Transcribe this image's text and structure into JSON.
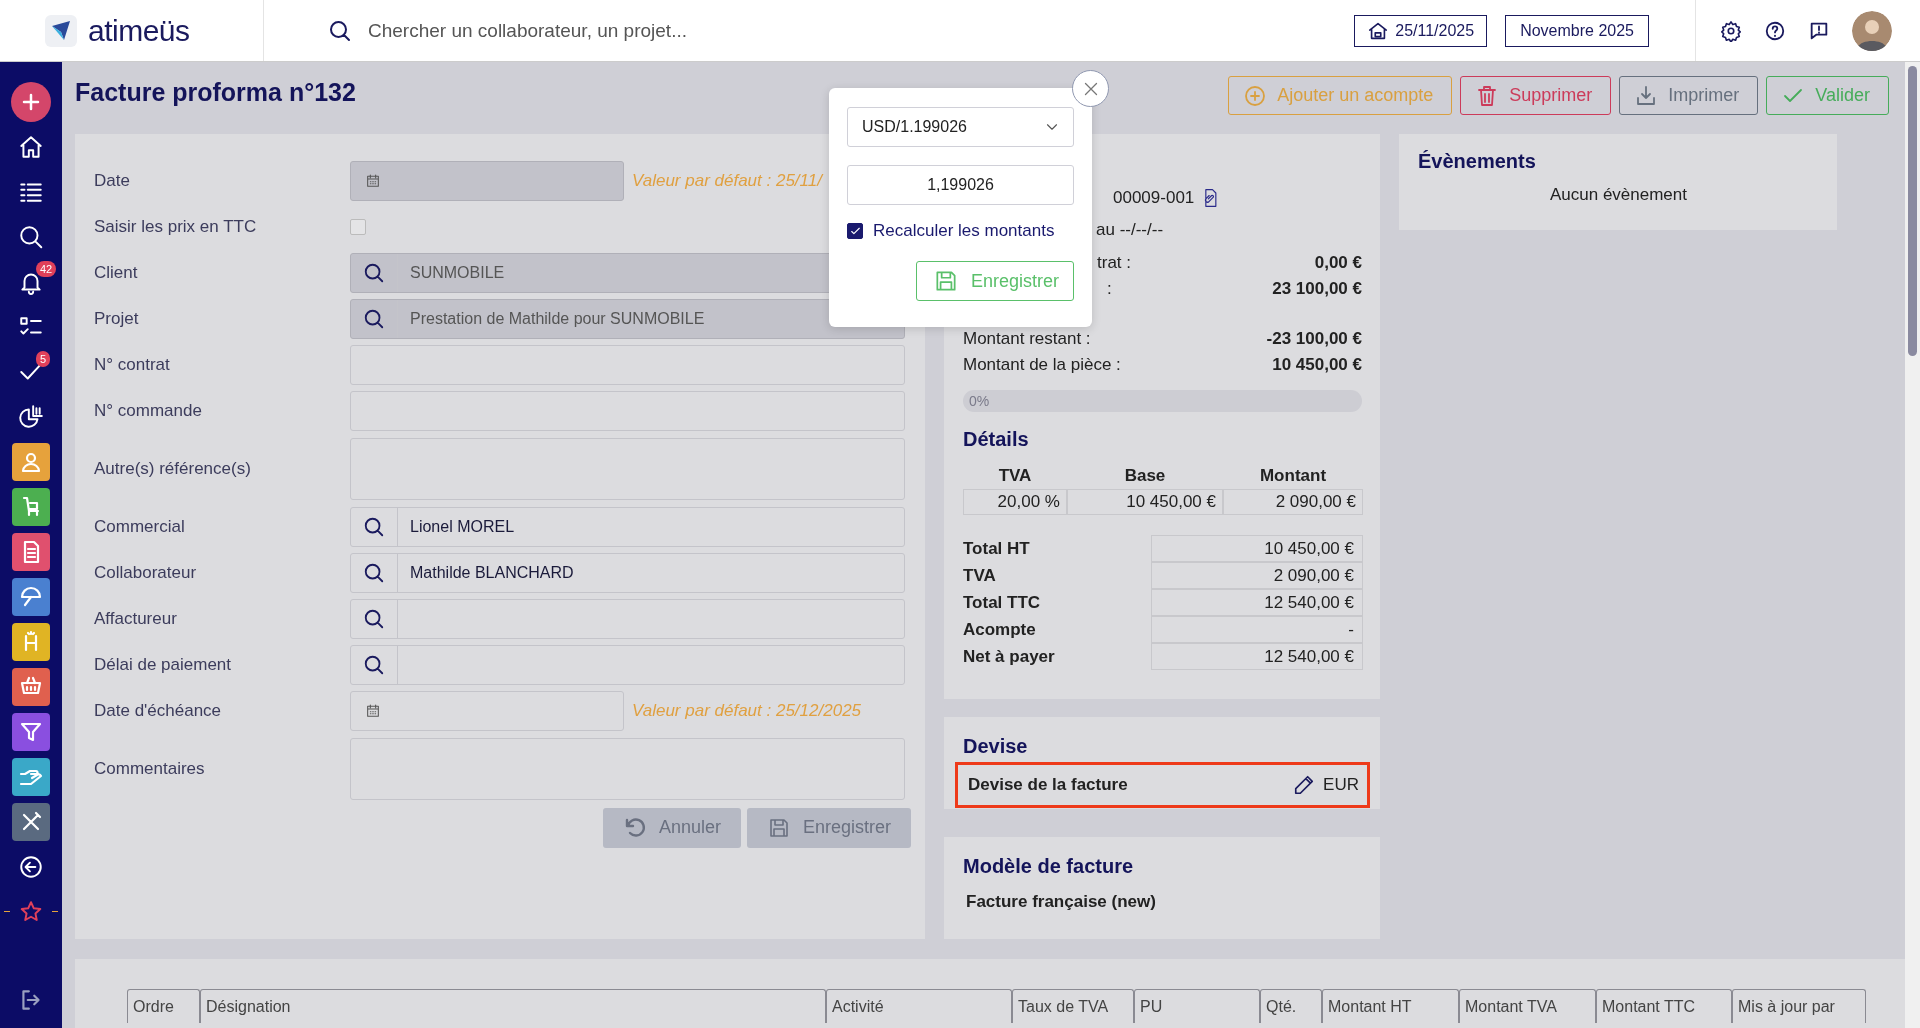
{
  "topbar": {
    "logo": "atimeüs",
    "search": {
      "placeholder": "Chercher un collaborateur, un projet..."
    },
    "date": "25/11/2025",
    "period": "Novembre 2025"
  },
  "sidebar": {
    "items": [
      {
        "kind": "round"
      },
      {
        "kind": "icon"
      },
      {
        "kind": "icon"
      },
      {
        "kind": "icon"
      },
      {
        "kind": "icon",
        "badge": "42"
      },
      {
        "kind": "icon"
      },
      {
        "kind": "icon",
        "badge": "5"
      },
      {
        "kind": "icon"
      },
      {
        "kind": "tile",
        "color": "#e6a23c"
      },
      {
        "kind": "tile",
        "color": "#4caf50"
      },
      {
        "kind": "tile",
        "color": "#e0506e"
      },
      {
        "kind": "tile",
        "color": "#4a80d0"
      },
      {
        "kind": "tile",
        "color": "#e0b424"
      },
      {
        "kind": "tile",
        "color": "#e0604e"
      },
      {
        "kind": "tile",
        "color": "#8a4fe0"
      },
      {
        "kind": "tile",
        "color": "#3aa8c8"
      },
      {
        "kind": "tile",
        "color": "#5a6a80"
      },
      {
        "kind": "icon"
      },
      {
        "kind": "favorite"
      },
      {
        "kind": "bottom"
      }
    ]
  },
  "page": {
    "title": "Facture proforma n°132",
    "actions": [
      {
        "label": "Ajouter un acompte",
        "kind": "add"
      },
      {
        "label": "Supprimer",
        "kind": "delete"
      },
      {
        "label": "Imprimer",
        "kind": "print"
      },
      {
        "label": "Valider",
        "kind": "validate"
      }
    ]
  },
  "form": {
    "fields": [
      {
        "label": "Date",
        "kind": "date",
        "disabled": true,
        "hint": "Valeur par défaut : 25/11/"
      },
      {
        "label": "Saisir les prix en TTC",
        "kind": "checkbox",
        "checked": false
      },
      {
        "label": "Client",
        "kind": "lookup",
        "value": "SUNMOBILE",
        "disabled": true
      },
      {
        "label": "Projet",
        "kind": "lookup",
        "value": "Prestation de Mathilde pour SUNMOBILE",
        "disabled": true
      },
      {
        "label": "N° contrat",
        "kind": "text"
      },
      {
        "label": "N° commande",
        "kind": "text"
      },
      {
        "label": "Autre(s) référence(s)",
        "kind": "textarea"
      },
      {
        "label": "Commercial",
        "kind": "lookup",
        "value": "Lionel MOREL",
        "disabled": false
      },
      {
        "label": "Collaborateur",
        "kind": "lookup",
        "value": "Mathilde BLANCHARD",
        "disabled": false
      },
      {
        "label": "Affactureur",
        "kind": "lookup",
        "disabled": false
      },
      {
        "label": "Délai de paiement",
        "kind": "lookup",
        "disabled": false
      },
      {
        "label": "Date d'échéance",
        "kind": "date",
        "disabled": false,
        "hint": "Valeur par défaut : 25/12/2025"
      },
      {
        "label": "Commentaires",
        "kind": "textarea"
      }
    ],
    "buttons": [
      {
        "label": "Annuler",
        "kind": "cancel",
        "disabled": true
      },
      {
        "label": "Enregistrer",
        "kind": "save",
        "disabled": true
      }
    ]
  },
  "summary": {
    "reference": "00009-001",
    "period": "au --/--/--",
    "amounts": [
      {
        "label": "trat :",
        "value": "0,00 €"
      },
      {
        "label": ":",
        "value": "23 100,00 €"
      },
      {
        "label": "Montant restant :",
        "value": "-23 100,00 €"
      },
      {
        "label": "Montant de la pièce :",
        "value": "10 450,00 €"
      }
    ],
    "progress": {
      "label": "0%",
      "level": 0
    },
    "details": {
      "title": "Détails",
      "columns": [
        "TVA",
        "Base",
        "Montant"
      ],
      "rows": [
        [
          "20,00 %",
          "10 450,00 €",
          "2 090,00 €"
        ]
      ],
      "totals": [
        {
          "label": "Total HT",
          "value": "10 450,00 €"
        },
        {
          "label": "TVA",
          "value": "2 090,00 €"
        },
        {
          "label": "Total TTC",
          "value": "12 540,00 €"
        },
        {
          "label": "Acompte",
          "value": "-"
        },
        {
          "label": "Net à payer",
          "value": "12 540,00 €"
        }
      ]
    }
  },
  "currency": {
    "title": "Devise",
    "label": "Devise de la facture",
    "value": "EUR",
    "highlighted": true
  },
  "template": {
    "title": "Modèle de facture",
    "value": "Facture française (new)"
  },
  "events": {
    "title": "Évènements",
    "empty": "Aucun évènement"
  },
  "lines_table": {
    "columns": [
      "Ordre",
      "Désignation",
      "Activité",
      "Taux de TVA",
      "PU",
      "Qté.",
      "Montant HT",
      "Montant TVA",
      "Montant TTC",
      "Mis à jour par"
    ]
  },
  "popup": {
    "rate_select": "USD/1.199026",
    "rate": "1,199026",
    "recalculate": {
      "label": "Recalculer les montants",
      "checked": true
    },
    "save": "Enregistrer"
  }
}
